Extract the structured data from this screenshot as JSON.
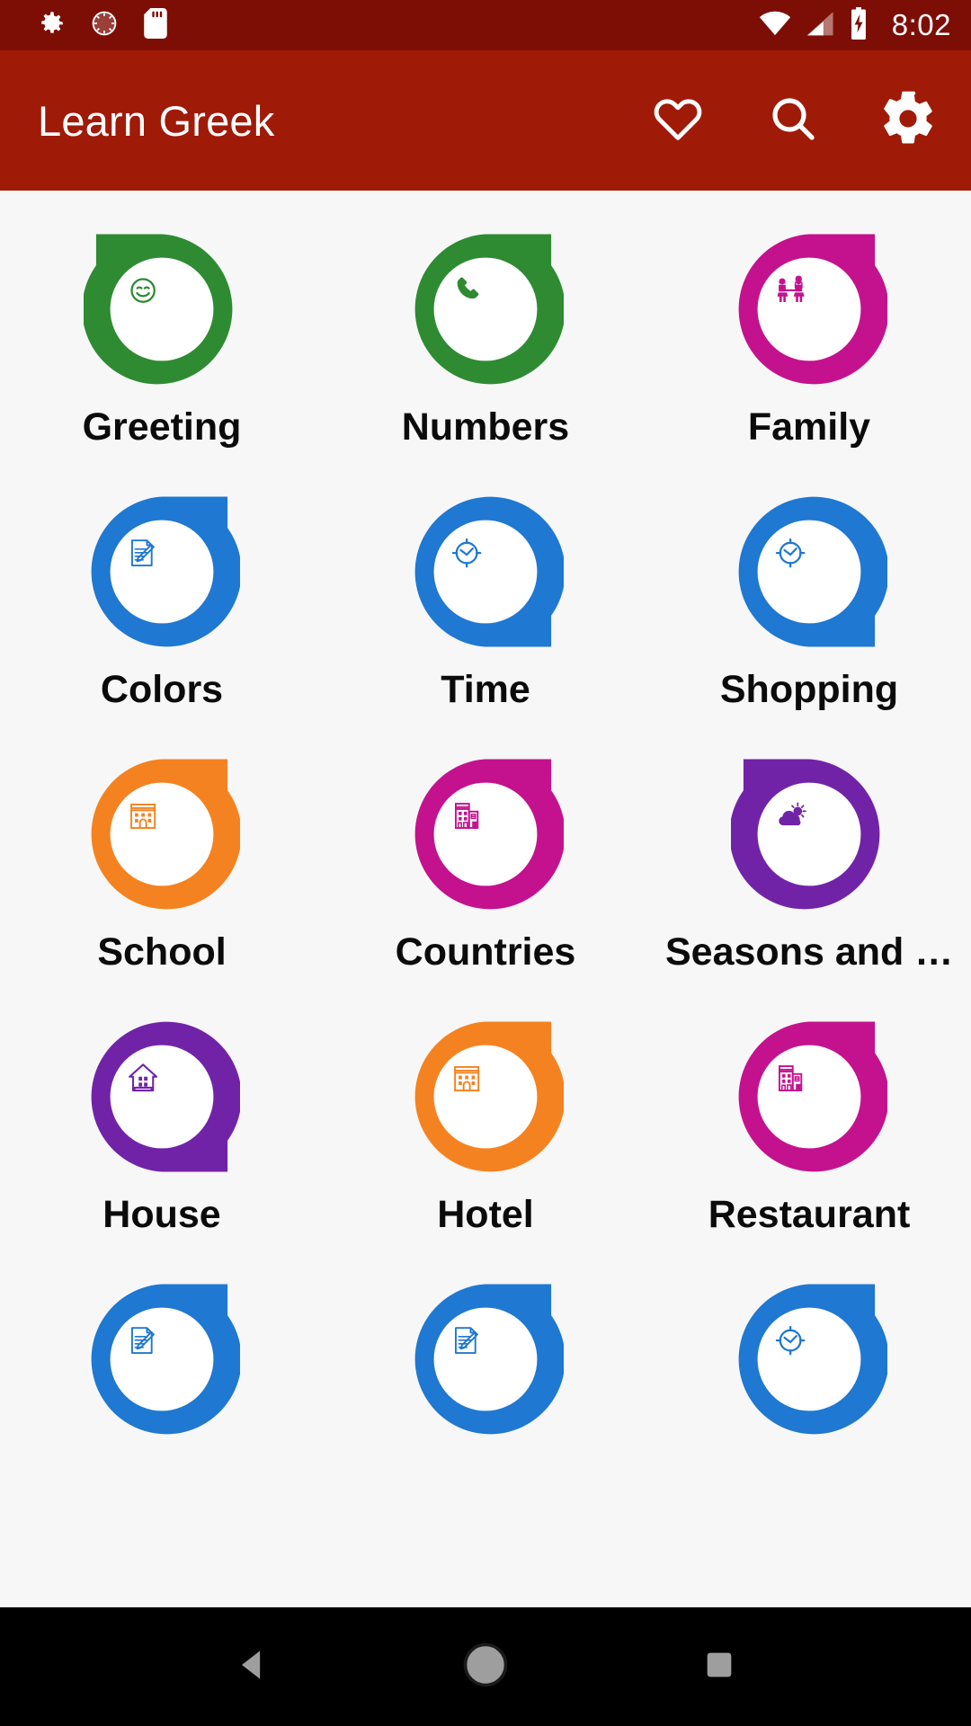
{
  "status_bar": {
    "background": "#7d0e06",
    "left_icons": [
      {
        "name": "settings-gear-icon",
        "glyph": "gear"
      },
      {
        "name": "screen-rotation-icon",
        "glyph": "moon-dial"
      },
      {
        "name": "sd-card-icon",
        "glyph": "sd-card"
      }
    ],
    "right_icons": [
      {
        "name": "wifi-icon",
        "glyph": "wifi"
      },
      {
        "name": "cellular-signal-icon",
        "glyph": "signal"
      },
      {
        "name": "battery-charging-icon",
        "glyph": "battery-bolt"
      }
    ],
    "clock": "8:02"
  },
  "app_bar": {
    "title": "Learn Greek",
    "background": "#a01a08",
    "text_color": "#ffffff",
    "actions": [
      {
        "name": "favorites-button",
        "icon": "heart-outline-icon",
        "label": "Favorites"
      },
      {
        "name": "search-button",
        "icon": "search-icon",
        "label": "Search"
      },
      {
        "name": "settings-button",
        "icon": "gear-icon",
        "label": "Settings"
      }
    ]
  },
  "grid": {
    "background": "#f7f7f7",
    "columns": 3,
    "items": [
      {
        "label": "Greeting",
        "color": "#2e8b32",
        "icon": "smiley-face-icon",
        "tail": "top-left"
      },
      {
        "label": "Numbers",
        "color": "#2e8b32",
        "icon": "telephone-icon",
        "tail": "top-right"
      },
      {
        "label": "Family",
        "color": "#c4128e",
        "icon": "family-couple-icon",
        "tail": "top-right"
      },
      {
        "label": "Colors",
        "color": "#1f78d1",
        "icon": "note-pencil-icon",
        "tail": "top-right"
      },
      {
        "label": "Time",
        "color": "#1f78d1",
        "icon": "clock-icon",
        "tail": "bottom-right"
      },
      {
        "label": "Shopping",
        "color": "#1f78d1",
        "icon": "clock-icon",
        "tail": "bottom-right"
      },
      {
        "label": "School",
        "color": "#f58220",
        "icon": "school-building-icon",
        "tail": "top-right"
      },
      {
        "label": "Countries",
        "color": "#c4128e",
        "icon": "city-buildings-icon",
        "tail": "top-right"
      },
      {
        "label": "Seasons and …",
        "color": "#7123a8",
        "icon": "sun-cloud-icon",
        "tail": "top-left"
      },
      {
        "label": "House",
        "color": "#7123a8",
        "icon": "house-icon",
        "tail": "bottom-right"
      },
      {
        "label": "Hotel",
        "color": "#f58220",
        "icon": "school-building-icon",
        "tail": "top-right"
      },
      {
        "label": "Restaurant",
        "color": "#c4128e",
        "icon": "city-buildings-icon",
        "tail": "top-right"
      },
      {
        "label": "",
        "color": "#1f78d1",
        "icon": "note-pencil-icon",
        "tail": "top-right"
      },
      {
        "label": "",
        "color": "#1f78d1",
        "icon": "note-pencil-icon",
        "tail": "top-right"
      },
      {
        "label": "",
        "color": "#1f78d1",
        "icon": "clock-icon",
        "tail": "top-right"
      }
    ]
  },
  "nav_bar": {
    "background": "#000000",
    "buttons": [
      {
        "name": "back-button",
        "icon": "back-triangle-icon",
        "label": "Back"
      },
      {
        "name": "home-button",
        "icon": "home-circle-icon",
        "label": "Home"
      },
      {
        "name": "recents-button",
        "icon": "recents-square-icon",
        "label": "Recents"
      }
    ]
  }
}
